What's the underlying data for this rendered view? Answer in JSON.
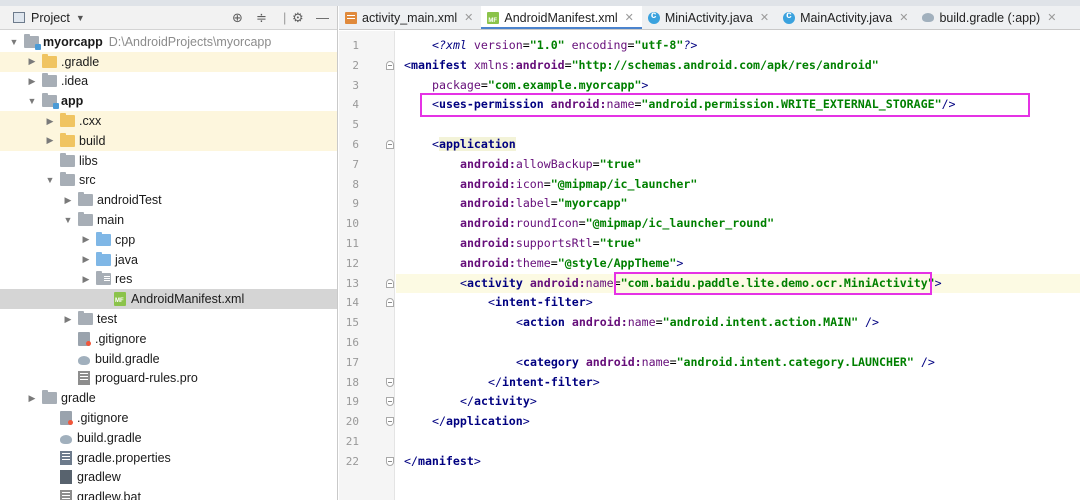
{
  "project_panel": {
    "title": "Project",
    "tree": [
      {
        "label": "myorcapp",
        "path": "D:\\AndroidProjects\\myorcapp",
        "indent": 0,
        "arrow": "down",
        "icon": "module-folder",
        "bold": true
      },
      {
        "label": ".gradle",
        "indent": 1,
        "arrow": "right",
        "icon": "folder-orange",
        "highlight": true
      },
      {
        "label": ".idea",
        "indent": 1,
        "arrow": "right",
        "icon": "folder"
      },
      {
        "label": "app",
        "indent": 1,
        "arrow": "down",
        "icon": "module-folder",
        "bold": true
      },
      {
        "label": ".cxx",
        "indent": 2,
        "arrow": "right",
        "icon": "folder-orange",
        "highlight": true
      },
      {
        "label": "build",
        "indent": 2,
        "arrow": "right",
        "icon": "folder-orange",
        "highlight": true
      },
      {
        "label": "libs",
        "indent": 2,
        "arrow": "none",
        "icon": "folder"
      },
      {
        "label": "src",
        "indent": 2,
        "arrow": "down",
        "icon": "folder"
      },
      {
        "label": "androidTest",
        "indent": 3,
        "arrow": "right",
        "icon": "folder"
      },
      {
        "label": "main",
        "indent": 3,
        "arrow": "down",
        "icon": "folder"
      },
      {
        "label": "cpp",
        "indent": 4,
        "arrow": "right",
        "icon": "folder-blue"
      },
      {
        "label": "java",
        "indent": 4,
        "arrow": "right",
        "icon": "folder-blue"
      },
      {
        "label": "res",
        "indent": 4,
        "arrow": "right",
        "icon": "folder-res"
      },
      {
        "label": "AndroidManifest.xml",
        "indent": 5,
        "arrow": "none",
        "icon": "manifest-file",
        "selected": true
      },
      {
        "label": "test",
        "indent": 3,
        "arrow": "right",
        "icon": "folder"
      },
      {
        "label": ".gitignore",
        "indent": 3,
        "arrow": "none",
        "icon": "gitignore-file"
      },
      {
        "label": "build.gradle",
        "indent": 3,
        "arrow": "none",
        "icon": "gradle-file"
      },
      {
        "label": "proguard-rules.pro",
        "indent": 3,
        "arrow": "none",
        "icon": "text-file"
      },
      {
        "label": "gradle",
        "indent": 1,
        "arrow": "right",
        "icon": "folder"
      },
      {
        "label": ".gitignore",
        "indent": 2,
        "arrow": "none",
        "icon": "gitignore-file"
      },
      {
        "label": "build.gradle",
        "indent": 2,
        "arrow": "none",
        "icon": "gradle-file"
      },
      {
        "label": "gradle.properties",
        "indent": 2,
        "arrow": "none",
        "icon": "properties-file"
      },
      {
        "label": "gradlew",
        "indent": 2,
        "arrow": "none",
        "icon": "terminal-file"
      },
      {
        "label": "gradlew.bat",
        "indent": 2,
        "arrow": "none",
        "icon": "text-file"
      }
    ]
  },
  "editor": {
    "tabs": [
      {
        "label": "activity_main.xml",
        "icon": "xml",
        "closable": true
      },
      {
        "label": "AndroidManifest.xml",
        "icon": "mf",
        "closable": true,
        "active": true
      },
      {
        "label": "MiniActivity.java",
        "icon": "java",
        "closable": true
      },
      {
        "label": "MainActivity.java",
        "icon": "java",
        "closable": true
      },
      {
        "label": "build.gradle (:app)",
        "icon": "gradle",
        "closable": true
      }
    ],
    "line_numbers": [
      "1",
      "2",
      "3",
      "4",
      "5",
      "6",
      "7",
      "8",
      "9",
      "10",
      "11",
      "12",
      "13",
      "14",
      "15",
      "16",
      "17",
      "18",
      "19",
      "20",
      "21",
      "22"
    ],
    "current_line_index": 12,
    "code": [
      {
        "indent": 4,
        "tokens": [
          [
            "decl",
            "<?"
          ],
          [
            "decl",
            "xml "
          ],
          [
            "attr",
            "version"
          ],
          [
            "plain",
            "="
          ],
          [
            "val",
            "\"1.0\""
          ],
          [
            "plain",
            " "
          ],
          [
            "attr",
            "encoding"
          ],
          [
            "plain",
            "="
          ],
          [
            "val",
            "\"utf-8\""
          ],
          [
            "decl",
            "?>"
          ]
        ]
      },
      {
        "indent": 0,
        "tokens": [
          [
            "ang",
            "<"
          ],
          [
            "tag",
            "manifest "
          ],
          [
            "attr",
            "xmlns:"
          ],
          [
            "attr b",
            "android"
          ],
          [
            "plain",
            "="
          ],
          [
            "val",
            "\"http://schemas.android.com/apk/res/android\""
          ]
        ]
      },
      {
        "indent": 4,
        "tokens": [
          [
            "attr",
            "package"
          ],
          [
            "plain",
            "="
          ],
          [
            "val",
            "\"com.example.myorcapp\""
          ],
          [
            "ang",
            ">"
          ]
        ]
      },
      {
        "indent": 4,
        "tokens": [
          [
            "ang",
            "<"
          ],
          [
            "tag",
            "uses-permission "
          ],
          [
            "attr b",
            "android:"
          ],
          [
            "attr",
            "name"
          ],
          [
            "plain",
            "="
          ],
          [
            "val",
            "\"android.permission.WRITE_EXTERNAL_STORAGE\""
          ],
          [
            "ang",
            "/>"
          ]
        ]
      },
      {
        "indent": 0,
        "tokens": []
      },
      {
        "indent": 4,
        "tokens": [
          [
            "ang",
            "<"
          ],
          [
            "tag tagbg",
            "application"
          ]
        ]
      },
      {
        "indent": 8,
        "tokens": [
          [
            "attr b",
            "android:"
          ],
          [
            "attr",
            "allowBackup"
          ],
          [
            "plain",
            "="
          ],
          [
            "val",
            "\"true\""
          ]
        ]
      },
      {
        "indent": 8,
        "tokens": [
          [
            "attr b",
            "android:"
          ],
          [
            "attr",
            "icon"
          ],
          [
            "plain",
            "="
          ],
          [
            "val",
            "\"@mipmap/ic_launcher\""
          ]
        ]
      },
      {
        "indent": 8,
        "tokens": [
          [
            "attr b",
            "android:"
          ],
          [
            "attr",
            "label"
          ],
          [
            "plain",
            "="
          ],
          [
            "val",
            "\"myorcapp\""
          ]
        ]
      },
      {
        "indent": 8,
        "tokens": [
          [
            "attr b",
            "android:"
          ],
          [
            "attr",
            "roundIcon"
          ],
          [
            "plain",
            "="
          ],
          [
            "val",
            "\"@mipmap/ic_launcher_round\""
          ]
        ]
      },
      {
        "indent": 8,
        "tokens": [
          [
            "attr b",
            "android:"
          ],
          [
            "attr",
            "supportsRtl"
          ],
          [
            "plain",
            "="
          ],
          [
            "val",
            "\"true\""
          ]
        ]
      },
      {
        "indent": 8,
        "tokens": [
          [
            "attr b",
            "android:"
          ],
          [
            "attr",
            "theme"
          ],
          [
            "plain",
            "="
          ],
          [
            "val",
            "\"@style/AppTheme\""
          ],
          [
            "ang",
            ">"
          ]
        ]
      },
      {
        "indent": 8,
        "tokens": [
          [
            "ang",
            "<"
          ],
          [
            "tag",
            "activity "
          ],
          [
            "attr b",
            "android:"
          ],
          [
            "attr",
            "name"
          ],
          [
            "plain",
            "="
          ],
          [
            "val",
            "\"com.baidu.paddle.lite.demo.ocr.MiniActivity\""
          ],
          [
            "ang",
            ">"
          ]
        ]
      },
      {
        "indent": 12,
        "tokens": [
          [
            "ang",
            "<"
          ],
          [
            "tag",
            "intent-filter"
          ],
          [
            "ang",
            ">"
          ]
        ]
      },
      {
        "indent": 16,
        "tokens": [
          [
            "ang",
            "<"
          ],
          [
            "tag",
            "action "
          ],
          [
            "attr b",
            "android:"
          ],
          [
            "attr",
            "name"
          ],
          [
            "plain",
            "="
          ],
          [
            "val",
            "\"android.intent.action.MAIN\""
          ],
          [
            "plain",
            " "
          ],
          [
            "ang",
            "/>"
          ]
        ]
      },
      {
        "indent": 0,
        "tokens": []
      },
      {
        "indent": 16,
        "tokens": [
          [
            "ang",
            "<"
          ],
          [
            "tag",
            "category "
          ],
          [
            "attr b",
            "android:"
          ],
          [
            "attr",
            "name"
          ],
          [
            "plain",
            "="
          ],
          [
            "val",
            "\"android.intent.category.LAUNCHER\""
          ],
          [
            "plain",
            " "
          ],
          [
            "ang",
            "/>"
          ]
        ]
      },
      {
        "indent": 12,
        "tokens": [
          [
            "ang",
            "</"
          ],
          [
            "tag",
            "intent-filter"
          ],
          [
            "ang",
            ">"
          ]
        ]
      },
      {
        "indent": 8,
        "tokens": [
          [
            "ang",
            "</"
          ],
          [
            "tag",
            "activity"
          ],
          [
            "ang",
            ">"
          ]
        ]
      },
      {
        "indent": 4,
        "tokens": [
          [
            "ang",
            "</"
          ],
          [
            "tag",
            "application"
          ],
          [
            "ang",
            ">"
          ]
        ]
      },
      {
        "indent": 0,
        "tokens": []
      },
      {
        "indent": 0,
        "tokens": [
          [
            "ang",
            "</"
          ],
          [
            "tag",
            "manifest"
          ],
          [
            "ang",
            ">"
          ]
        ]
      }
    ],
    "fold_markers": [
      {
        "line": 2,
        "kind": "start"
      },
      {
        "line": 6,
        "kind": "start"
      },
      {
        "line": 13,
        "kind": "start"
      },
      {
        "line": 14,
        "kind": "start"
      },
      {
        "line": 18,
        "kind": "end"
      },
      {
        "line": 19,
        "kind": "end"
      },
      {
        "line": 20,
        "kind": "end"
      },
      {
        "line": 22,
        "kind": "end"
      }
    ]
  },
  "colors": {
    "highlight_box": "#e532e5",
    "tab_underline": "#4b83cd",
    "selected_row": "#d5d5d5"
  }
}
